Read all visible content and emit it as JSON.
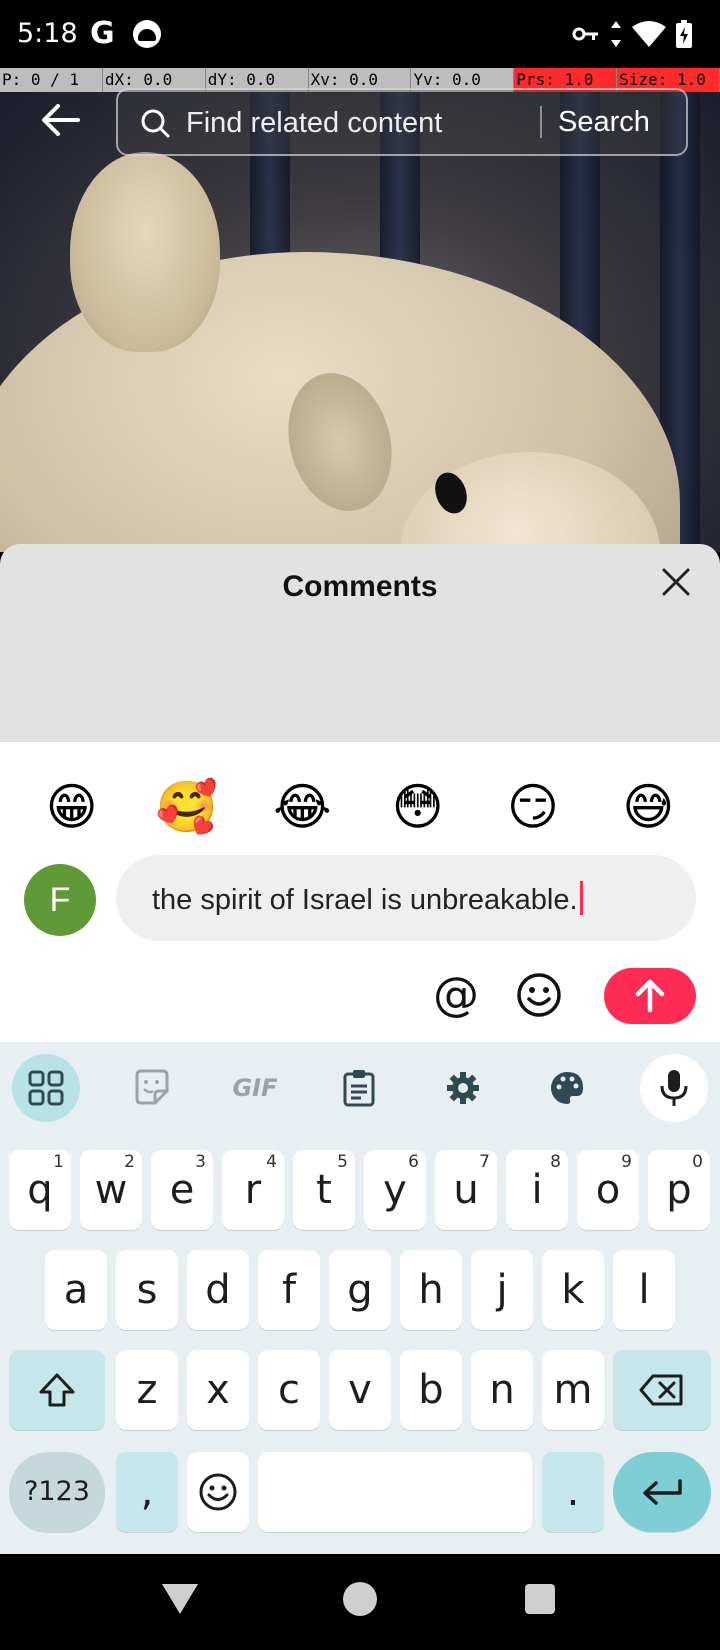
{
  "status": {
    "time": "5:18",
    "carrier_glyph": "G"
  },
  "debug": {
    "p": "P: 0 / 1",
    "dx": "dX: 0.0",
    "dy": "dY: 0.0",
    "xv": "Xv: 0.0",
    "yv": "Yv: 0.0",
    "prs": "Prs: 1.0",
    "size": "Size: 1.0"
  },
  "search": {
    "placeholder": "Find related content",
    "button": "Search"
  },
  "comments": {
    "title": "Comments"
  },
  "emoji_bar": [
    "😁",
    "🥰",
    "😂",
    "😳",
    "😏",
    "😅"
  ],
  "compose": {
    "avatar_letter": "F",
    "text": "the spirit of Israel is unbreakable.",
    "mention_symbol": "@"
  },
  "keyboard": {
    "toolbar": [
      "apps-icon",
      "sticker-icon",
      "GIF",
      "clipboard-icon",
      "settings-icon",
      "palette-icon",
      "mic-icon"
    ],
    "gif_label": "GIF",
    "row1": [
      {
        "k": "q",
        "n": "1"
      },
      {
        "k": "w",
        "n": "2"
      },
      {
        "k": "e",
        "n": "3"
      },
      {
        "k": "r",
        "n": "4"
      },
      {
        "k": "t",
        "n": "5"
      },
      {
        "k": "y",
        "n": "6"
      },
      {
        "k": "u",
        "n": "7"
      },
      {
        "k": "i",
        "n": "8"
      },
      {
        "k": "o",
        "n": "9"
      },
      {
        "k": "p",
        "n": "0"
      }
    ],
    "row2": [
      "a",
      "s",
      "d",
      "f",
      "g",
      "h",
      "j",
      "k",
      "l"
    ],
    "row3": [
      "z",
      "x",
      "c",
      "v",
      "b",
      "n",
      "m"
    ],
    "symbols_label": "?123",
    "comma": ",",
    "period": "."
  },
  "colors": {
    "accent": "#fe2c55",
    "avatar": "#5f9a37",
    "keyboard_bg": "#e8eff2",
    "enter_key": "#7ecfd5"
  }
}
